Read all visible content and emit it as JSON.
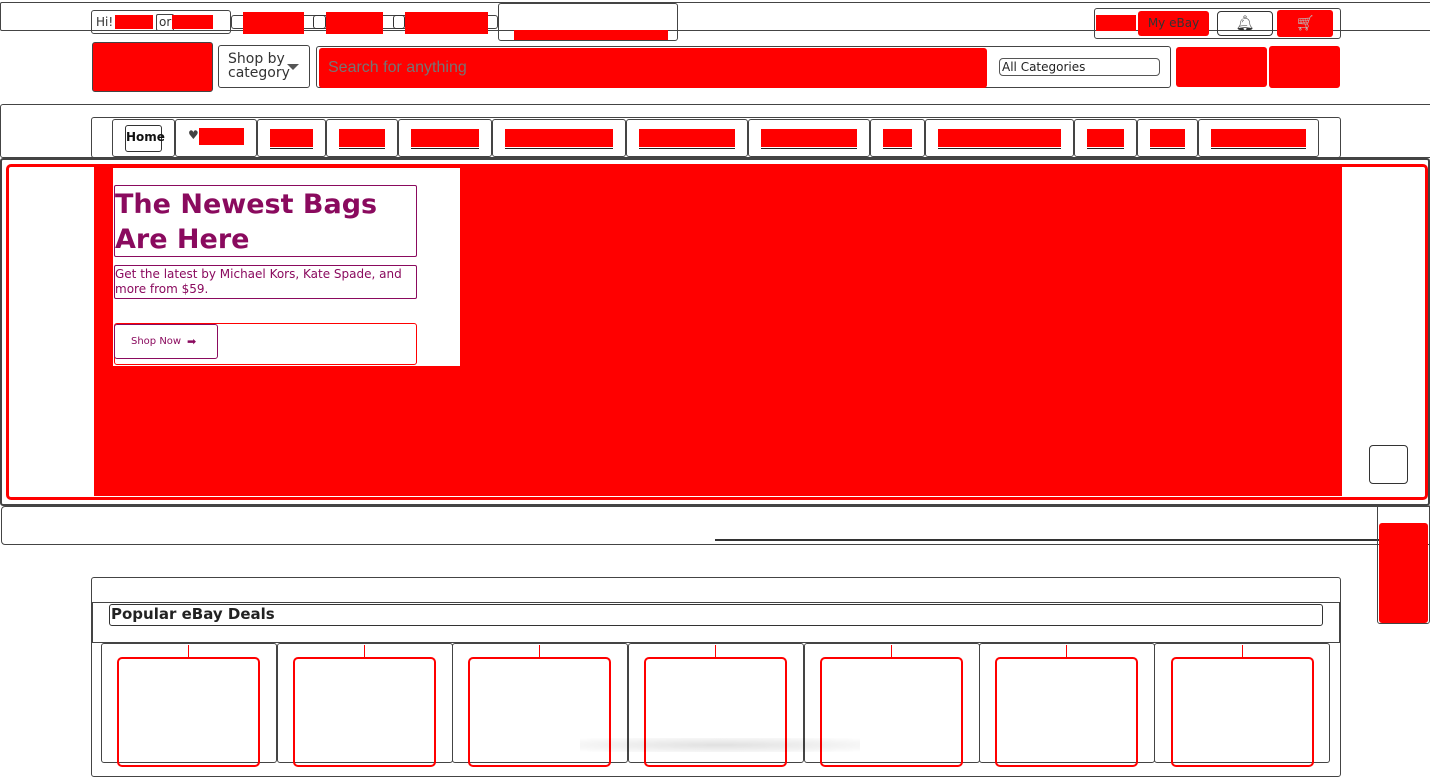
{
  "header": {
    "greeting": "Hi!",
    "or_text": "or",
    "my_ebay": "My eBay",
    "bell_icon": "bell-icon",
    "cart_icon": "cart-icon"
  },
  "search": {
    "shop_by_category": "Shop by category",
    "placeholder": "Search for anything",
    "category": "All Categories"
  },
  "nav": {
    "home": "Home",
    "heart_icon": "heart-icon"
  },
  "hero": {
    "title": "The Newest Bags Are Here",
    "subtitle": "Get the latest by Michael Kors, Kate Spade, and more from $59.",
    "button": "Shop Now",
    "button_icon": "arrow-right-circle-icon"
  },
  "deals": {
    "title": "Popular eBay Deals"
  },
  "colors": {
    "redaction": "#ff0000",
    "hero_text": "#8a0a5e"
  }
}
